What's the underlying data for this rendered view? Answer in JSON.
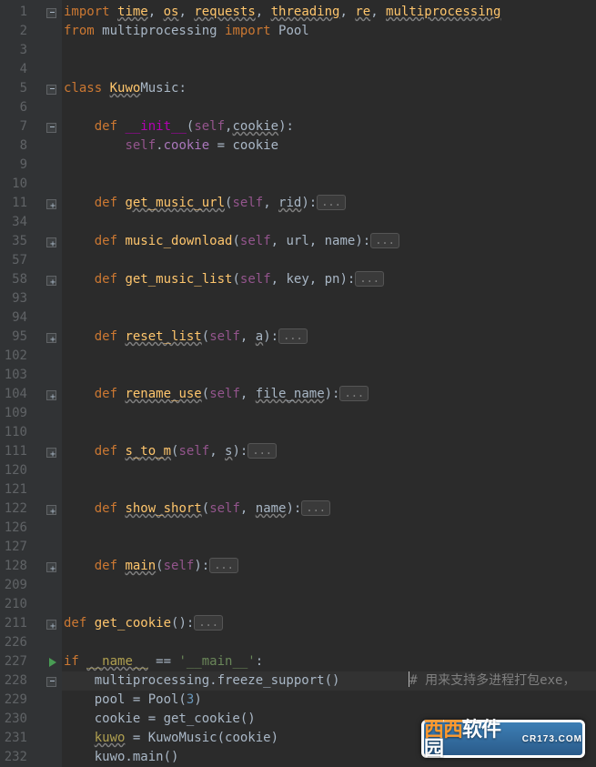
{
  "editor": {
    "line_numbers": [
      1,
      2,
      3,
      4,
      5,
      6,
      7,
      8,
      9,
      10,
      11,
      34,
      35,
      57,
      58,
      93,
      94,
      95,
      102,
      103,
      104,
      109,
      110,
      111,
      120,
      121,
      122,
      126,
      127,
      128,
      209,
      210,
      211,
      226,
      227,
      228,
      229,
      230,
      231,
      232
    ],
    "fold_markers": {
      "0": "minus",
      "4": "minus",
      "6": "minus",
      "10": "plus",
      "12": "plus",
      "14": "plus",
      "17": "plus",
      "20": "plus",
      "23": "plus",
      "26": "plus",
      "29": "plus",
      "32": "plus",
      "34": "play",
      "35": "minus"
    },
    "caret_line_index": 35,
    "lines": [
      {
        "indent": 0,
        "tokens": [
          {
            "cls": "kw",
            "t": "import"
          },
          {
            "cls": "pun",
            "t": " "
          },
          {
            "cls": "fnamu",
            "t": "time"
          },
          {
            "cls": "pun",
            "t": ", "
          },
          {
            "cls": "fnamu",
            "t": "os"
          },
          {
            "cls": "pun",
            "t": ", "
          },
          {
            "cls": "fnamu",
            "t": "requests"
          },
          {
            "cls": "pun",
            "t": ", "
          },
          {
            "cls": "fnamu",
            "t": "threading"
          },
          {
            "cls": "pun",
            "t": ", "
          },
          {
            "cls": "fnamu",
            "t": "re"
          },
          {
            "cls": "pun",
            "t": ", "
          },
          {
            "cls": "fnamu",
            "t": "multiprocessing"
          }
        ]
      },
      {
        "indent": 0,
        "tokens": [
          {
            "cls": "kw",
            "t": "from"
          },
          {
            "cls": "pun",
            "t": " multiprocessing "
          },
          {
            "cls": "kw",
            "t": "import"
          },
          {
            "cls": "pun",
            "t": " Pool"
          }
        ]
      },
      {
        "indent": 0,
        "tokens": []
      },
      {
        "indent": 0,
        "tokens": []
      },
      {
        "indent": 0,
        "tokens": [
          {
            "cls": "kw",
            "t": "class"
          },
          {
            "cls": "pun",
            "t": " "
          },
          {
            "cls": "fnamu",
            "t": "Kuwo"
          },
          {
            "cls": "pun",
            "t": "Music:"
          }
        ]
      },
      {
        "indent": 0,
        "tokens": []
      },
      {
        "indent": 1,
        "tokens": [
          {
            "cls": "kw",
            "t": "def"
          },
          {
            "cls": "pun",
            "t": " "
          },
          {
            "cls": "mag",
            "t": "__init__"
          },
          {
            "cls": "pun",
            "t": "("
          },
          {
            "cls": "self",
            "t": "self"
          },
          {
            "cls": "pun",
            "t": ","
          },
          {
            "cls": "par",
            "t": "cookie"
          },
          {
            "cls": "pun",
            "t": "):"
          }
        ]
      },
      {
        "indent": 2,
        "tokens": [
          {
            "cls": "self",
            "t": "self"
          },
          {
            "cls": "pun",
            "t": "."
          },
          {
            "cls": "prop",
            "t": "cookie"
          },
          {
            "cls": "pun",
            "t": " = cookie"
          }
        ]
      },
      {
        "indent": 0,
        "tokens": []
      },
      {
        "indent": 0,
        "tokens": []
      },
      {
        "indent": 1,
        "tokens": [
          {
            "cls": "kw",
            "t": "def"
          },
          {
            "cls": "pun",
            "t": " "
          },
          {
            "cls": "fnamu",
            "t": "get_music_url"
          },
          {
            "cls": "pun",
            "t": "("
          },
          {
            "cls": "self",
            "t": "self"
          },
          {
            "cls": "pun",
            "t": ", "
          },
          {
            "cls": "par",
            "t": "rid"
          },
          {
            "cls": "pun",
            "t": "):"
          },
          {
            "cls": "fold",
            "t": "..."
          }
        ]
      },
      {
        "indent": 0,
        "tokens": []
      },
      {
        "indent": 1,
        "tokens": [
          {
            "cls": "kw",
            "t": "def"
          },
          {
            "cls": "pun",
            "t": " "
          },
          {
            "cls": "fnam",
            "t": "music_download"
          },
          {
            "cls": "pun",
            "t": "("
          },
          {
            "cls": "self",
            "t": "self"
          },
          {
            "cls": "pun",
            "t": ", url, name):"
          },
          {
            "cls": "fold",
            "t": "..."
          }
        ]
      },
      {
        "indent": 0,
        "tokens": []
      },
      {
        "indent": 1,
        "tokens": [
          {
            "cls": "kw",
            "t": "def"
          },
          {
            "cls": "pun",
            "t": " "
          },
          {
            "cls": "fnam",
            "t": "get_music_list"
          },
          {
            "cls": "pun",
            "t": "("
          },
          {
            "cls": "self",
            "t": "self"
          },
          {
            "cls": "pun",
            "t": ", key, pn):"
          },
          {
            "cls": "fold",
            "t": "..."
          }
        ]
      },
      {
        "indent": 0,
        "tokens": []
      },
      {
        "indent": 0,
        "tokens": []
      },
      {
        "indent": 1,
        "tokens": [
          {
            "cls": "kw",
            "t": "def"
          },
          {
            "cls": "pun",
            "t": " "
          },
          {
            "cls": "fnamu",
            "t": "reset_list"
          },
          {
            "cls": "pun",
            "t": "("
          },
          {
            "cls": "self",
            "t": "self"
          },
          {
            "cls": "pun",
            "t": ", "
          },
          {
            "cls": "par",
            "t": "a"
          },
          {
            "cls": "pun",
            "t": "):"
          },
          {
            "cls": "fold",
            "t": "..."
          }
        ]
      },
      {
        "indent": 0,
        "tokens": []
      },
      {
        "indent": 0,
        "tokens": []
      },
      {
        "indent": 1,
        "tokens": [
          {
            "cls": "kw",
            "t": "def"
          },
          {
            "cls": "pun",
            "t": " "
          },
          {
            "cls": "fnamu",
            "t": "rename_use"
          },
          {
            "cls": "pun",
            "t": "("
          },
          {
            "cls": "self",
            "t": "self"
          },
          {
            "cls": "pun",
            "t": ", "
          },
          {
            "cls": "par",
            "t": "file_name"
          },
          {
            "cls": "pun",
            "t": "):"
          },
          {
            "cls": "fold",
            "t": "..."
          }
        ]
      },
      {
        "indent": 0,
        "tokens": []
      },
      {
        "indent": 0,
        "tokens": []
      },
      {
        "indent": 1,
        "tokens": [
          {
            "cls": "kw",
            "t": "def"
          },
          {
            "cls": "pun",
            "t": " "
          },
          {
            "cls": "fnamu",
            "t": "s_to_m"
          },
          {
            "cls": "pun",
            "t": "("
          },
          {
            "cls": "self",
            "t": "self"
          },
          {
            "cls": "pun",
            "t": ", "
          },
          {
            "cls": "par",
            "t": "s"
          },
          {
            "cls": "pun",
            "t": "):"
          },
          {
            "cls": "fold",
            "t": "..."
          }
        ]
      },
      {
        "indent": 0,
        "tokens": []
      },
      {
        "indent": 0,
        "tokens": []
      },
      {
        "indent": 1,
        "tokens": [
          {
            "cls": "kw",
            "t": "def"
          },
          {
            "cls": "pun",
            "t": " "
          },
          {
            "cls": "fnamu",
            "t": "show_short"
          },
          {
            "cls": "pun",
            "t": "("
          },
          {
            "cls": "self",
            "t": "self"
          },
          {
            "cls": "pun",
            "t": ", "
          },
          {
            "cls": "par",
            "t": "name"
          },
          {
            "cls": "pun",
            "t": "):"
          },
          {
            "cls": "fold",
            "t": "..."
          }
        ]
      },
      {
        "indent": 0,
        "tokens": []
      },
      {
        "indent": 0,
        "tokens": []
      },
      {
        "indent": 1,
        "tokens": [
          {
            "cls": "kw",
            "t": "def"
          },
          {
            "cls": "pun",
            "t": " "
          },
          {
            "cls": "fnamu",
            "t": "main"
          },
          {
            "cls": "pun",
            "t": "("
          },
          {
            "cls": "self",
            "t": "self"
          },
          {
            "cls": "pun",
            "t": "):"
          },
          {
            "cls": "fold",
            "t": "..."
          }
        ]
      },
      {
        "indent": 0,
        "tokens": []
      },
      {
        "indent": 0,
        "tokens": []
      },
      {
        "indent": 0,
        "tokens": [
          {
            "cls": "kw",
            "t": "def"
          },
          {
            "cls": "pun",
            "t": " "
          },
          {
            "cls": "fnam",
            "t": "get_cookie"
          },
          {
            "cls": "pun",
            "t": "():"
          },
          {
            "cls": "fold",
            "t": "..."
          }
        ]
      },
      {
        "indent": 0,
        "tokens": []
      },
      {
        "indent": 0,
        "tokens": [
          {
            "cls": "kw",
            "t": "if"
          },
          {
            "cls": "pun",
            "t": " "
          },
          {
            "cls": "fnamd",
            "t": "__name__"
          },
          {
            "cls": "pun",
            "t": " == "
          },
          {
            "cls": "str",
            "t": "'__main__'"
          },
          {
            "cls": "pun",
            "t": ":"
          }
        ]
      },
      {
        "indent": 1,
        "caret_after_token": 0,
        "tokens": [
          {
            "cls": "pun",
            "t": "multiprocessing.freeze_support()         "
          },
          {
            "cls": "cmt",
            "t": "# 用来支持多进程打包exe，"
          }
        ]
      },
      {
        "indent": 1,
        "tokens": [
          {
            "cls": "pun",
            "t": "pool = Pool("
          },
          {
            "cls": "num",
            "t": "3"
          },
          {
            "cls": "pun",
            "t": ")"
          }
        ]
      },
      {
        "indent": 1,
        "tokens": [
          {
            "cls": "pun",
            "t": "cookie = get_cookie()"
          }
        ]
      },
      {
        "indent": 1,
        "tokens": [
          {
            "cls": "fnamd",
            "t": "kuwo"
          },
          {
            "cls": "pun",
            "t": " = KuwoMusic(cookie)"
          }
        ]
      },
      {
        "indent": 1,
        "tokens": [
          {
            "cls": "pun",
            "t": "kuwo.main()"
          }
        ]
      }
    ]
  },
  "watermark": {
    "brand_left": "西西",
    "brand_right": "软件园",
    "url": "CR173.COM"
  }
}
